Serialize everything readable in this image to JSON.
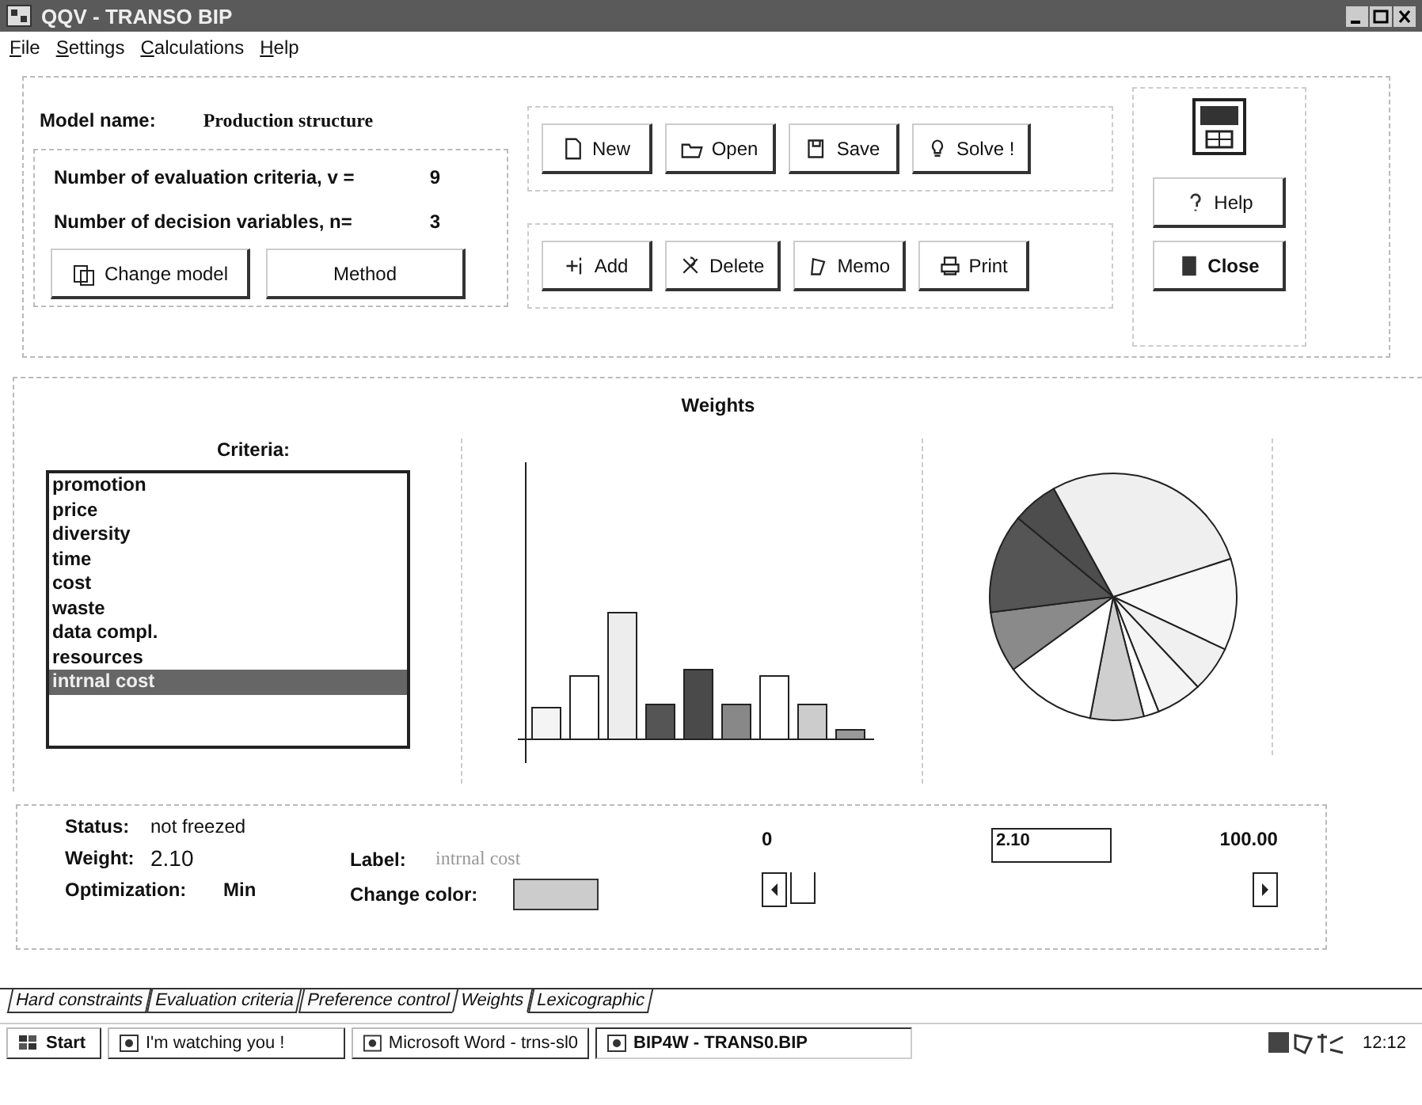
{
  "window": {
    "title": "QQV - TRANSO BIP"
  },
  "menu": [
    {
      "label": "File"
    },
    {
      "label": "Settings"
    },
    {
      "label": "Calculations"
    },
    {
      "label": "Help"
    }
  ],
  "model": {
    "name_label": "Model name:",
    "name": "Production structure",
    "criteria_label": "Number of evaluation criteria, v =",
    "criteria_count": "9",
    "variables_label": "Number of decision variables, n=",
    "variables_count": "3",
    "buttons": [
      "Change model",
      "Method"
    ]
  },
  "toolbar_top": [
    {
      "label": "New"
    },
    {
      "label": "Open"
    },
    {
      "label": "Save"
    },
    {
      "label": "Solve !"
    }
  ],
  "toolbar_bottom": [
    {
      "label": "Add"
    },
    {
      "label": "Delete"
    },
    {
      "label": "Memo"
    },
    {
      "label": "Print"
    }
  ],
  "side_buttons": [
    {
      "label": "Help"
    },
    {
      "label": "Close"
    }
  ],
  "weights": {
    "title": "Weights",
    "criteria_title": "Criteria:",
    "criteria": [
      {
        "label": "promotion",
        "selected": false
      },
      {
        "label": "price",
        "selected": false
      },
      {
        "label": "diversity",
        "selected": false
      },
      {
        "label": "time",
        "selected": false
      },
      {
        "label": "cost",
        "selected": false
      },
      {
        "label": "waste",
        "selected": false
      },
      {
        "label": "data compl.",
        "selected": false
      },
      {
        "label": "resources",
        "selected": false
      },
      {
        "label": "intrnal cost",
        "selected": true
      }
    ]
  },
  "details": {
    "status_label": "Status:",
    "status": "not freezed",
    "weight_label": "Weight:",
    "weight": "2.10",
    "optimization_label": "Optimization:",
    "optimization": "Min",
    "label_label": "Label:",
    "label": "intrnal cost",
    "color_label": "Change color:",
    "slider_min": "0",
    "slider_value": "2.10",
    "slider_max": "100.00"
  },
  "tabs": [
    {
      "label": "Hard constraints",
      "selected": false
    },
    {
      "label": "Evaluation criteria",
      "selected": false
    },
    {
      "label": "Preference control",
      "selected": false
    },
    {
      "label": "Weights",
      "selected": true
    },
    {
      "label": "Lexicographic",
      "selected": false
    }
  ],
  "taskbar": {
    "start": "Start",
    "tasks": [
      {
        "label": "I'm watching you !",
        "selected": false
      },
      {
        "label": "Microsoft Word - trns-sl0",
        "selected": false
      },
      {
        "label": "BIP4W - TRANS0.BIP",
        "selected": true
      }
    ],
    "clock": "12:12"
  }
}
